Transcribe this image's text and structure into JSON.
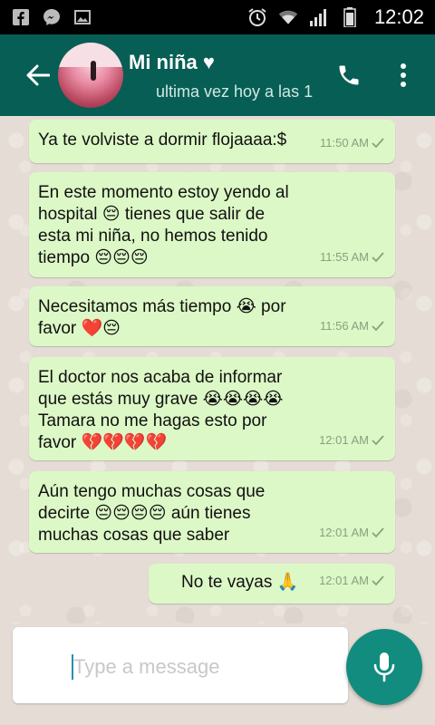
{
  "status_bar": {
    "time": "12:02",
    "left_icons": [
      "facebook-icon",
      "messenger-icon",
      "gallery-icon"
    ],
    "right_icons": [
      "alarm-icon",
      "wifi-icon",
      "signal-icon",
      "battery-icon"
    ]
  },
  "header": {
    "contact_name": "Mi niña ♥",
    "last_seen": "ultima vez hoy a las 1",
    "accent_color": "#075e54"
  },
  "messages": [
    {
      "text": "Ya te volviste a dormir flojaaaa:$",
      "time": "11:50 AM"
    },
    {
      "text": "En este momento estoy yendo al\nhospital 😔 tienes que salir de\nesta mi niña, no hemos tenido\ntiempo 😔😔😔",
      "time": "11:55 AM"
    },
    {
      "text": "Necesitamos más tiempo 😭 por\nfavor ❤️😔",
      "time": "11:56 AM"
    },
    {
      "text": "El doctor nos acaba de informar\nque estás muy grave 😭😭😭😭\nTamara no me hagas esto por\nfavor 💔💔💔💔",
      "time": "12:01 AM"
    },
    {
      "text": "Aún tengo muchas cosas que\ndecirte 😔😔😔😔 aún tienes\nmuchas cosas que saber",
      "time": "12:01 AM"
    },
    {
      "text": "No te vayas 🙏",
      "time": "12:01 AM"
    }
  ],
  "input": {
    "placeholder": "Type a message",
    "value": ""
  },
  "colors": {
    "bubble": "#dcf8c6",
    "chat_bg": "#e5ddd5",
    "mic_button": "#128c7e"
  }
}
